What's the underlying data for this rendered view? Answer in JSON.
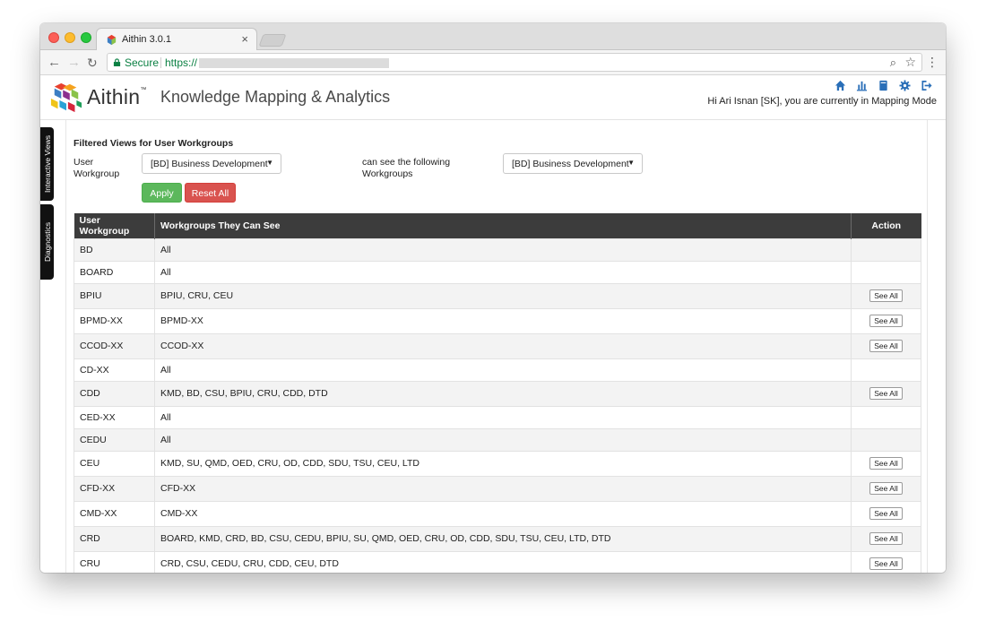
{
  "browser": {
    "tab_title": "Aithin 3.0.1",
    "tab_close": "×",
    "secure_label": "Secure",
    "url_scheme": "https://"
  },
  "header": {
    "brand": "Aithin",
    "brand_tm": "™",
    "title": "Knowledge Mapping & Analytics",
    "greeting": "Hi Ari Isnan [SK], you are currently in Mapping Mode",
    "icons": [
      "home-icon",
      "bar-chart-icon",
      "book-icon",
      "gear-icon",
      "sign-out-icon"
    ],
    "accent_color": "#2a6fb8"
  },
  "side_tabs": {
    "interactive_views": "Interactive Views",
    "diagnostics": "Diagnostics"
  },
  "filter": {
    "title": "Filtered Views for User Workgroups",
    "user_workgroup_label": "User Workgroup",
    "user_workgroup_value": "[BD] Business Development I",
    "can_see_label": "can see the following Workgroups",
    "can_see_value": "[BD] Business Development I",
    "apply_label": "Apply",
    "reset_label": "Reset All",
    "apply_color": "#5cb85c",
    "reset_color": "#d9534f"
  },
  "table": {
    "headers": [
      "User Workgroup",
      "Workgroups They Can See",
      "Action"
    ],
    "see_all_label": "See All",
    "rows": [
      {
        "group": "BD",
        "visible": "All",
        "action": false
      },
      {
        "group": "BOARD",
        "visible": "All",
        "action": false
      },
      {
        "group": "BPIU",
        "visible": "BPIU, CRU, CEU",
        "action": true
      },
      {
        "group": "BPMD-XX",
        "visible": "BPMD-XX",
        "action": true
      },
      {
        "group": "CCOD-XX",
        "visible": "CCOD-XX",
        "action": true
      },
      {
        "group": "CD-XX",
        "visible": "All",
        "action": false
      },
      {
        "group": "CDD",
        "visible": "KMD, BD, CSU, BPIU, CRU, CDD, DTD",
        "action": true
      },
      {
        "group": "CED-XX",
        "visible": "All",
        "action": false
      },
      {
        "group": "CEDU",
        "visible": "All",
        "action": false
      },
      {
        "group": "CEU",
        "visible": "KMD, SU, QMD, OED, CRU, OD, CDD, SDU, TSU, CEU, LTD",
        "action": true
      },
      {
        "group": "CFD-XX",
        "visible": "CFD-XX",
        "action": true
      },
      {
        "group": "CMD-XX",
        "visible": "CMD-XX",
        "action": true
      },
      {
        "group": "CRD",
        "visible": "BOARD, KMD, CRD, BD, CSU, CEDU, BPIU, SU, QMD, OED, CRU, OD, CDD, SDU, TSU, CEU, LTD, DTD",
        "action": true
      },
      {
        "group": "CRU",
        "visible": "CRD, CSU, CEDU, CRU, CDD, CEU, DTD",
        "action": true
      }
    ]
  }
}
